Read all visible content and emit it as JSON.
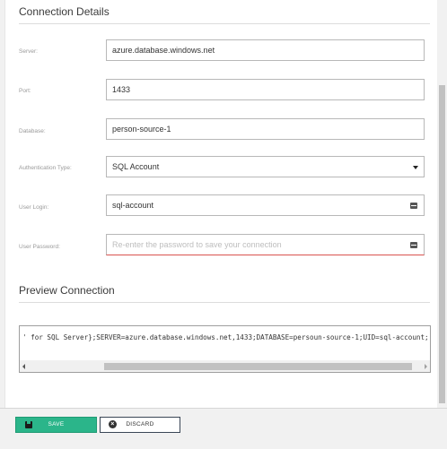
{
  "connection_details": {
    "title": "Connection Details",
    "fields": {
      "server": {
        "label": "Server:",
        "value": "azure.database.windows.net"
      },
      "port": {
        "label": "Port:",
        "value": "1433"
      },
      "database": {
        "label": "Database:",
        "value": "person-source-1"
      },
      "auth_type": {
        "label": "Authentication Type:",
        "value": "SQL Account"
      },
      "user_login": {
        "label": "User Login:",
        "value": "sql-account"
      },
      "user_password": {
        "label": "User Password:",
        "value": "",
        "placeholder": "Re-enter the password to save your connection"
      }
    }
  },
  "preview": {
    "title": "Preview Connection",
    "text": "' for SQL Server};SERVER=azure.database.windows.net,1433;DATABASE=persoun-source-1;UID=sql-account;"
  },
  "footer": {
    "save_label": "SAVE",
    "discard_label": "DISCARD"
  },
  "colors": {
    "save_bg": "#2bb58a",
    "password_underline": "#d9534f"
  },
  "icons": {
    "password_toggle": "key-card-icon",
    "dropdown": "caret-down-icon",
    "save": "floppy-disk-icon",
    "discard": "x-circle-icon"
  }
}
